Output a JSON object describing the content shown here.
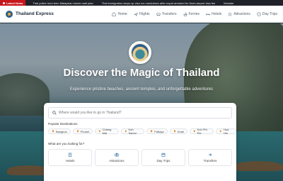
{
  "ticker": {
    "label": "Latest News",
    "items": [
      "Thai police hunt teen Malaysian hunter wall plan",
      "Thai immigration steps up visa run crackdown after expat arrested for three-airport visa fee",
      "Monster"
    ]
  },
  "header": {
    "brand": "Thailand Express",
    "nav": [
      {
        "label": "Home",
        "icon": "home-icon"
      },
      {
        "label": "Flights",
        "icon": "plane-icon"
      },
      {
        "label": "Transfers",
        "icon": "car-icon"
      },
      {
        "label": "Ferries",
        "icon": "boat-icon"
      },
      {
        "label": "Hotels",
        "icon": "bed-icon"
      },
      {
        "label": "Attractions",
        "icon": "star-icon"
      },
      {
        "label": "Day Trips",
        "icon": "compass-icon"
      }
    ]
  },
  "hero": {
    "title": "Discover the Magic of Thailand",
    "subtitle": "Experience pristine beaches, ancient temples, and unforgettable adventures"
  },
  "search": {
    "placeholder": "Where would you like to go in Thailand?",
    "popular_label": "Popular Destinations",
    "destinations": [
      "Bangkok",
      "Phuket",
      "Chiang Mai",
      "Koh Samui",
      "Pattaya",
      "Krabi",
      "Koh Phi Phi",
      "Hua Hin"
    ],
    "looking_label": "What are you looking for?",
    "categories": [
      {
        "label": "Hotels",
        "icon": "building-icon"
      },
      {
        "label": "Attractions",
        "icon": "camera-icon"
      },
      {
        "label": "Day Trips",
        "icon": "calendar-icon"
      },
      {
        "label": "Transfers",
        "icon": "arrow-right-icon"
      }
    ]
  },
  "colors": {
    "accent": "#c8161d",
    "brand_text": "#1b2a3a",
    "icon_blue": "#2d6fa8"
  }
}
